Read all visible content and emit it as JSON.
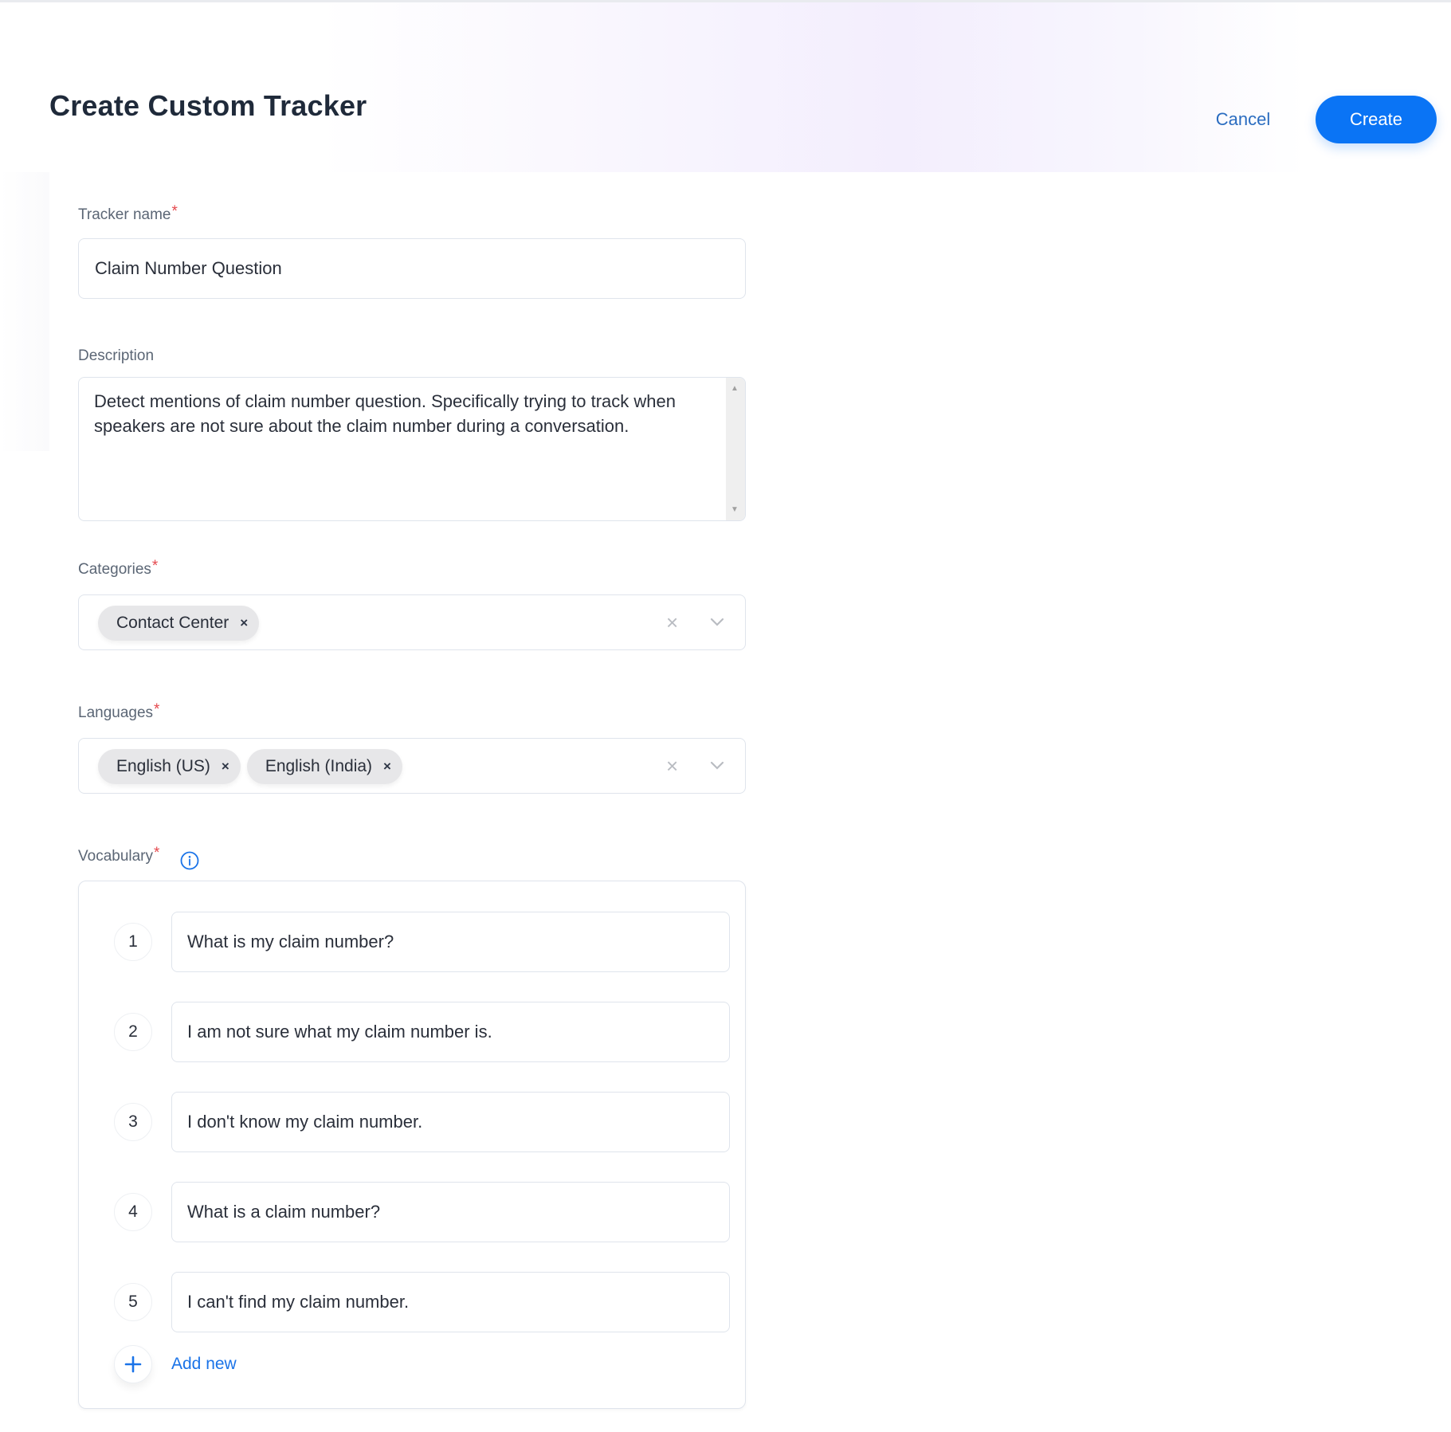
{
  "header": {
    "title": "Create Custom Tracker",
    "cancel_label": "Cancel",
    "create_label": "Create"
  },
  "form": {
    "tracker_name": {
      "label": "Tracker name",
      "required_mark": "*",
      "value": "Claim Number Question"
    },
    "description": {
      "label": "Description",
      "value": "Detect mentions of claim number question. Specifically trying to track when speakers are not sure about the claim number during a conversation."
    },
    "categories": {
      "label": "Categories",
      "required_mark": "*",
      "selected": [
        "Contact Center"
      ],
      "clear_icon": "×"
    },
    "languages": {
      "label": "Languages",
      "required_mark": "*",
      "selected": [
        "English (US)",
        "English (India)"
      ],
      "clear_icon": "×"
    },
    "vocabulary": {
      "label": "Vocabulary",
      "required_mark": "*",
      "items": [
        {
          "number": "1",
          "value": "What is my claim number?"
        },
        {
          "number": "2",
          "value": "I am not sure what my claim number is."
        },
        {
          "number": "3",
          "value": "I don't know my claim number."
        },
        {
          "number": "4",
          "value": "What is a claim number?"
        },
        {
          "number": "5",
          "value": "I can't find my claim number."
        }
      ],
      "add_new_label": "Add new"
    }
  },
  "chip_remove_glyph": "×",
  "colors": {
    "primary": "#0a74f5",
    "link": "#1a73e8",
    "required": "#e5484d"
  }
}
